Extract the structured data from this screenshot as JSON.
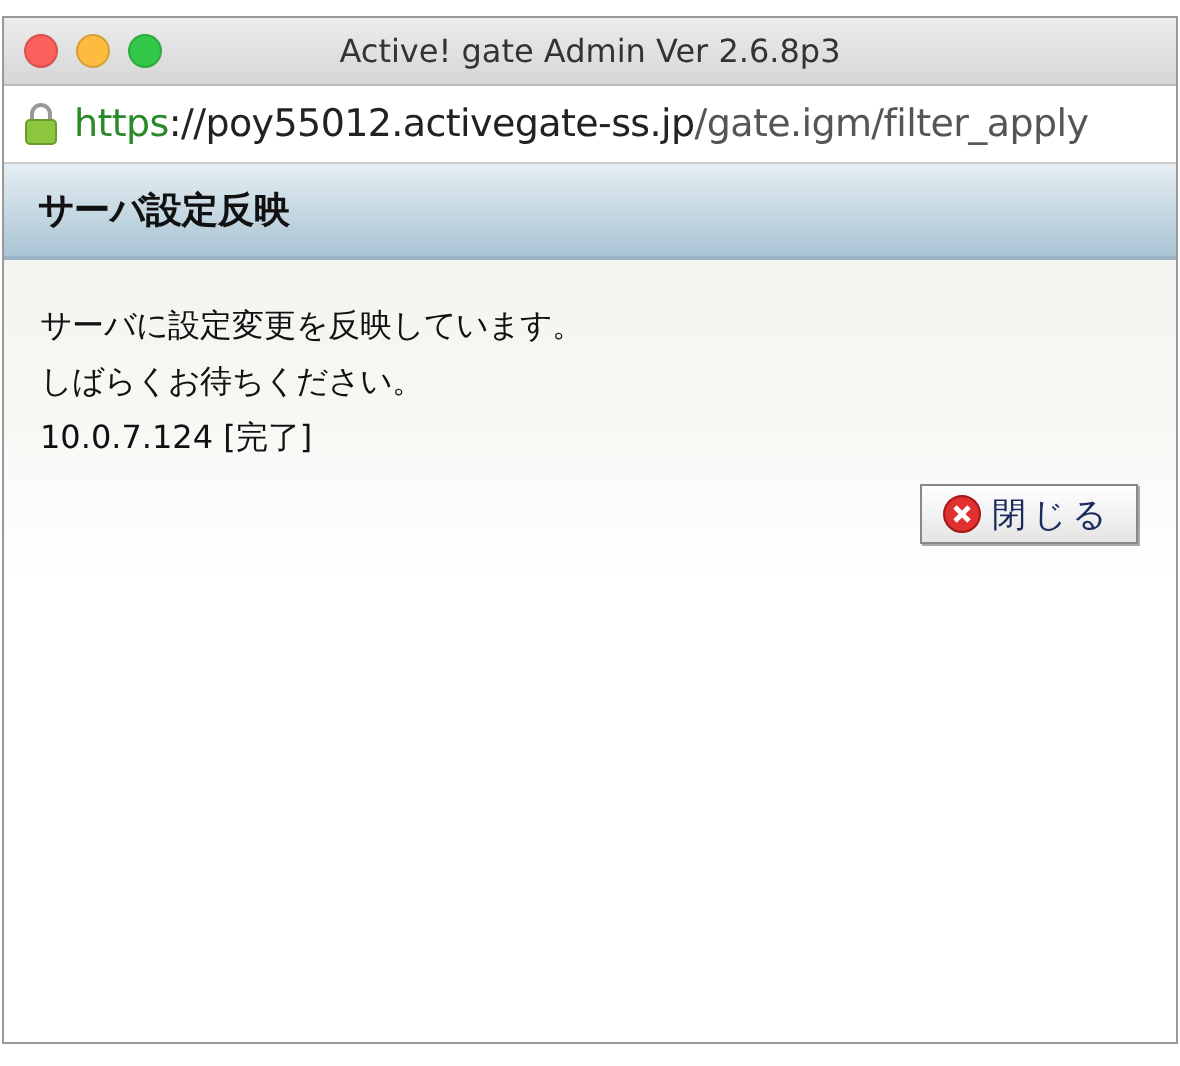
{
  "window": {
    "title": "Active! gate Admin Ver 2.6.8p3"
  },
  "address_bar": {
    "scheme": "https",
    "host": "://poy55012.activegate-ss.jp",
    "path": "/gate.igm/filter_apply"
  },
  "page": {
    "heading": "サーバ設定反映",
    "messages": [
      "サーバに設定変更を反映しています。",
      "しばらくお待ちください。",
      "10.0.7.124 [完了]"
    ],
    "close_button": {
      "label": "閉じる"
    }
  }
}
